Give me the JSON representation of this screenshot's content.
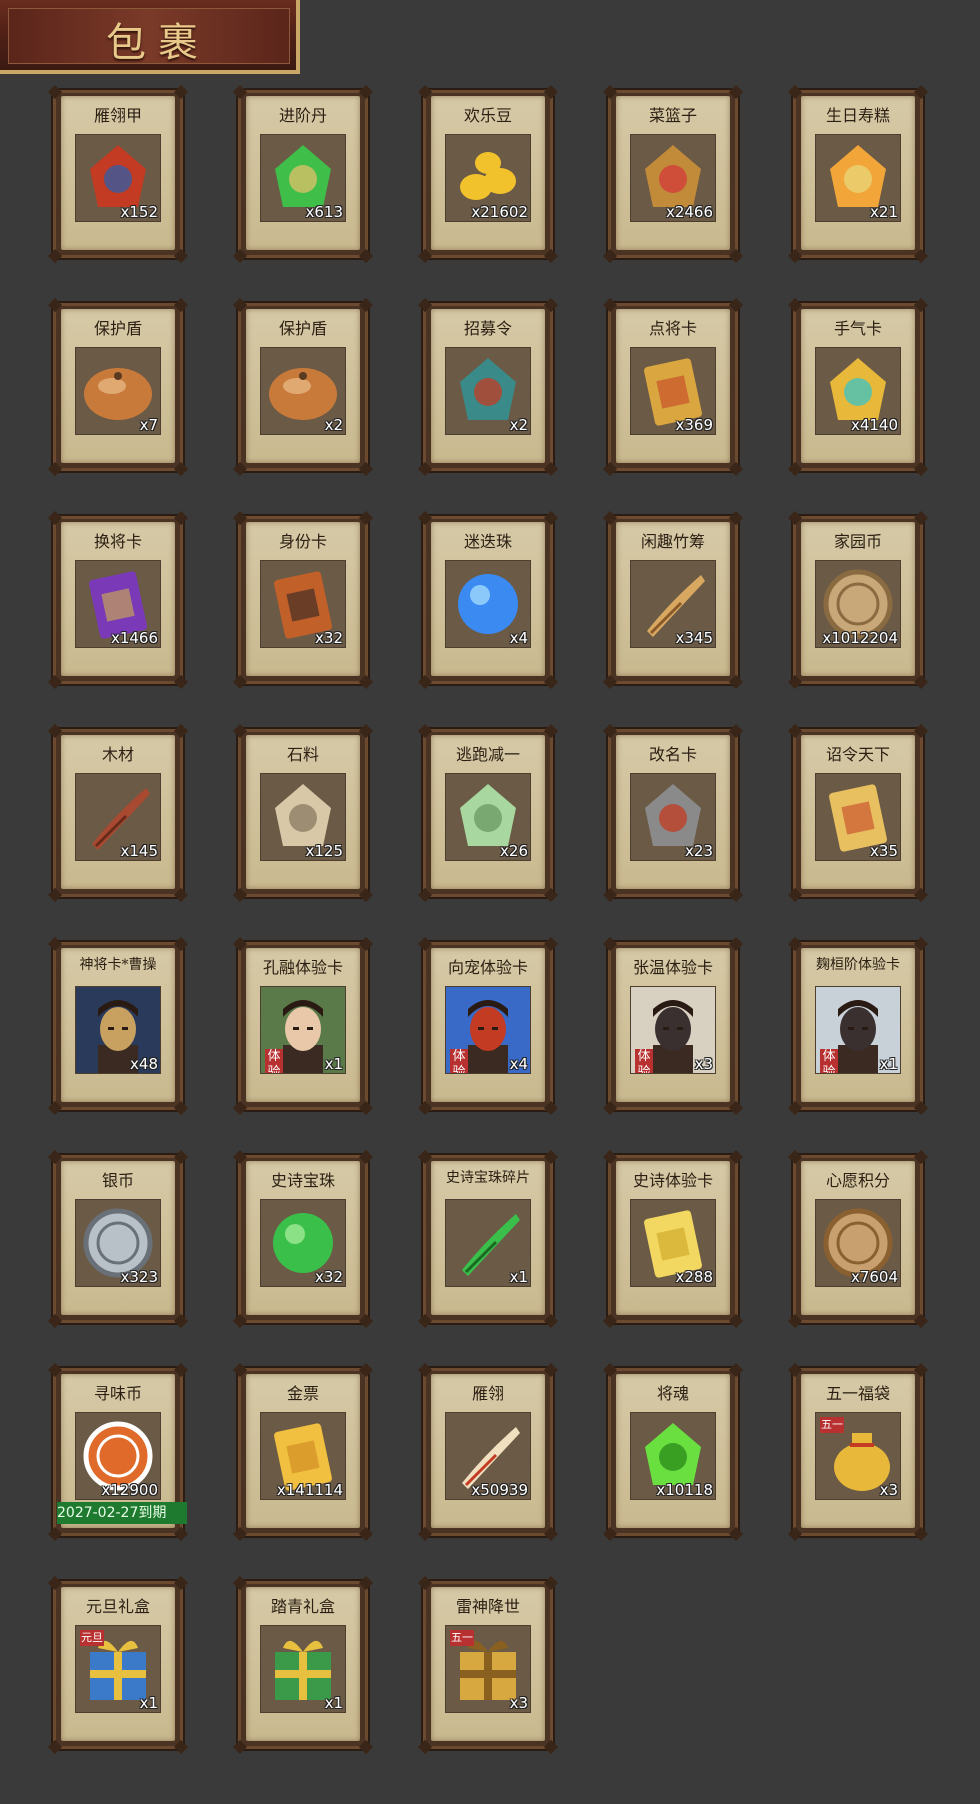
{
  "header": {
    "title": "包裹"
  },
  "items": [
    {
      "name": "雁翎甲",
      "count": "x152",
      "icon": "armor-icon",
      "colors": [
        "#c23b22",
        "#2f5fa8",
        "#d9a640"
      ]
    },
    {
      "name": "进阶丹",
      "count": "x613",
      "icon": "green-pill-icon",
      "colors": [
        "#3fbf4a",
        "#e3c06a"
      ]
    },
    {
      "name": "欢乐豆",
      "count": "x21602",
      "icon": "gold-beans-icon",
      "colors": [
        "#f2c22c",
        "#b88a12"
      ]
    },
    {
      "name": "菜篮子",
      "count": "x2466",
      "icon": "basket-icon",
      "colors": [
        "#c28b3a",
        "#d33a3a",
        "#4aa14a"
      ]
    },
    {
      "name": "生日寿糕",
      "count": "x21",
      "icon": "cake-icon",
      "colors": [
        "#f2a63a",
        "#e8d67a"
      ]
    },
    {
      "name": "保护盾",
      "count": "x7",
      "icon": "shield-icon",
      "colors": [
        "#c87a3a",
        "#f2c898"
      ]
    },
    {
      "name": "保护盾",
      "count": "x2",
      "icon": "shield-icon",
      "colors": [
        "#c87a3a",
        "#f2c898"
      ]
    },
    {
      "name": "招募令",
      "count": "x2",
      "icon": "helmet-token-icon",
      "colors": [
        "#3a8a8a",
        "#c23b22"
      ]
    },
    {
      "name": "点将卡",
      "count": "x369",
      "icon": "general-card-icon",
      "colors": [
        "#d9a640",
        "#c23b22",
        "#3a7a3a"
      ]
    },
    {
      "name": "手气卡",
      "count": "x4140",
      "icon": "jade-token-icon",
      "colors": [
        "#e8b83a",
        "#3ac4c4"
      ]
    },
    {
      "name": "换将卡",
      "count": "x1466",
      "icon": "swap-card-icon",
      "colors": [
        "#7a3ab8",
        "#d9c040",
        "#3a8a3a"
      ]
    },
    {
      "name": "身份卡",
      "count": "x32",
      "icon": "identity-card-icon",
      "colors": [
        "#c2602a",
        "#222222",
        "#ffffff"
      ]
    },
    {
      "name": "迷迭珠",
      "count": "x4",
      "icon": "blue-orb-icon",
      "colors": [
        "#3a8af2",
        "#aee4ff"
      ]
    },
    {
      "name": "闲趣竹筹",
      "count": "x345",
      "icon": "bamboo-sticks-icon",
      "colors": [
        "#d9a860",
        "#8a5a2a"
      ]
    },
    {
      "name": "家园币",
      "count": "x1012204",
      "icon": "home-coin-icon",
      "colors": [
        "#c8a878",
        "#8a6a40"
      ]
    },
    {
      "name": "木材",
      "count": "x145",
      "icon": "wood-icon",
      "colors": [
        "#a84a32",
        "#6a2a1a"
      ]
    },
    {
      "name": "石料",
      "count": "x125",
      "icon": "stone-icon",
      "colors": [
        "#d8c8a8",
        "#8a7a60"
      ]
    },
    {
      "name": "逃跑减一",
      "count": "x26",
      "icon": "jade-tag-icon",
      "colors": [
        "#a8d8a0",
        "#6a9a60"
      ]
    },
    {
      "name": "改名卡",
      "count": "x23",
      "icon": "rename-token-icon",
      "colors": [
        "#8a8a8a",
        "#c23b22"
      ]
    },
    {
      "name": "诏令天下",
      "count": "x35",
      "icon": "scroll-icon",
      "colors": [
        "#e8c060",
        "#c23b22"
      ]
    },
    {
      "name": "神将卡*曹操",
      "count": "x48",
      "icon": "portrait-caocao-icon",
      "colors": [
        "#2a3a5a",
        "#c8a060"
      ],
      "portrait": true
    },
    {
      "name": "孔融体验卡",
      "count": "x1",
      "icon": "portrait-kongrong-icon",
      "colors": [
        "#5a7a4a",
        "#e8c8a8"
      ],
      "portrait": true,
      "tag": "体验"
    },
    {
      "name": "向宠体验卡",
      "count": "x4",
      "icon": "portrait-xiangchong-icon",
      "colors": [
        "#3a6ac8",
        "#c23b22"
      ],
      "portrait": true,
      "tag": "体验"
    },
    {
      "name": "张温体验卡",
      "count": "x3",
      "icon": "portrait-zhangwen-icon",
      "colors": [
        "#d8d0c0",
        "#3a3030"
      ],
      "portrait": true,
      "tag": "体验"
    },
    {
      "name": "麹桓阶体验卡",
      "count": "x1",
      "icon": "portrait-huanjie-icon",
      "colors": [
        "#c8d0d8",
        "#3a3030"
      ],
      "portrait": true,
      "tag": "体验"
    },
    {
      "name": "银币",
      "count": "x323",
      "icon": "silver-coin-icon",
      "colors": [
        "#b8c0c8",
        "#6a7078"
      ]
    },
    {
      "name": "史诗宝珠",
      "count": "x32",
      "icon": "green-orb-icon",
      "colors": [
        "#3ac04a",
        "#aef0a0"
      ]
    },
    {
      "name": "史诗宝珠碎片",
      "count": "x1",
      "icon": "green-shard-icon",
      "colors": [
        "#3ac04a",
        "#1a6a22"
      ]
    },
    {
      "name": "史诗体验卡",
      "count": "x288",
      "icon": "gold-card-icon",
      "colors": [
        "#f2d860",
        "#c8a020"
      ]
    },
    {
      "name": "心愿积分",
      "count": "x7604",
      "icon": "heart-coin-icon",
      "colors": [
        "#c8a070",
        "#8a6030"
      ]
    },
    {
      "name": "寻味币",
      "count": "x12900",
      "icon": "flavor-coin-icon",
      "colors": [
        "#e06a2a",
        "#ffffff"
      ],
      "expiry": "2027-02-27到期"
    },
    {
      "name": "金票",
      "count": "x141114",
      "icon": "gold-ticket-icon",
      "colors": [
        "#f2c040",
        "#c8801a"
      ]
    },
    {
      "name": "雁翎",
      "count": "x50939",
      "icon": "feather-icon",
      "colors": [
        "#f0e0c0",
        "#c23b22"
      ]
    },
    {
      "name": "将魂",
      "count": "x10118",
      "icon": "soul-crystal-icon",
      "colors": [
        "#6ae040",
        "#2a8a1a"
      ]
    },
    {
      "name": "五一福袋",
      "count": "x3",
      "icon": "lucky-bag-icon",
      "colors": [
        "#e8b83a",
        "#c23b22"
      ],
      "tag2": "五一"
    },
    {
      "name": "元旦礼盒",
      "count": "x1",
      "icon": "gift-box-blue-icon",
      "colors": [
        "#3a7ac8",
        "#e8c040"
      ],
      "tag2": "元旦"
    },
    {
      "name": "踏青礼盒",
      "count": "x1",
      "icon": "gift-box-green-icon",
      "colors": [
        "#3a9a4a",
        "#e8c040"
      ]
    },
    {
      "name": "雷神降世",
      "count": "x3",
      "icon": "gift-box-gold-icon",
      "colors": [
        "#d8a840",
        "#8a6020"
      ],
      "tag2": "五一"
    }
  ]
}
